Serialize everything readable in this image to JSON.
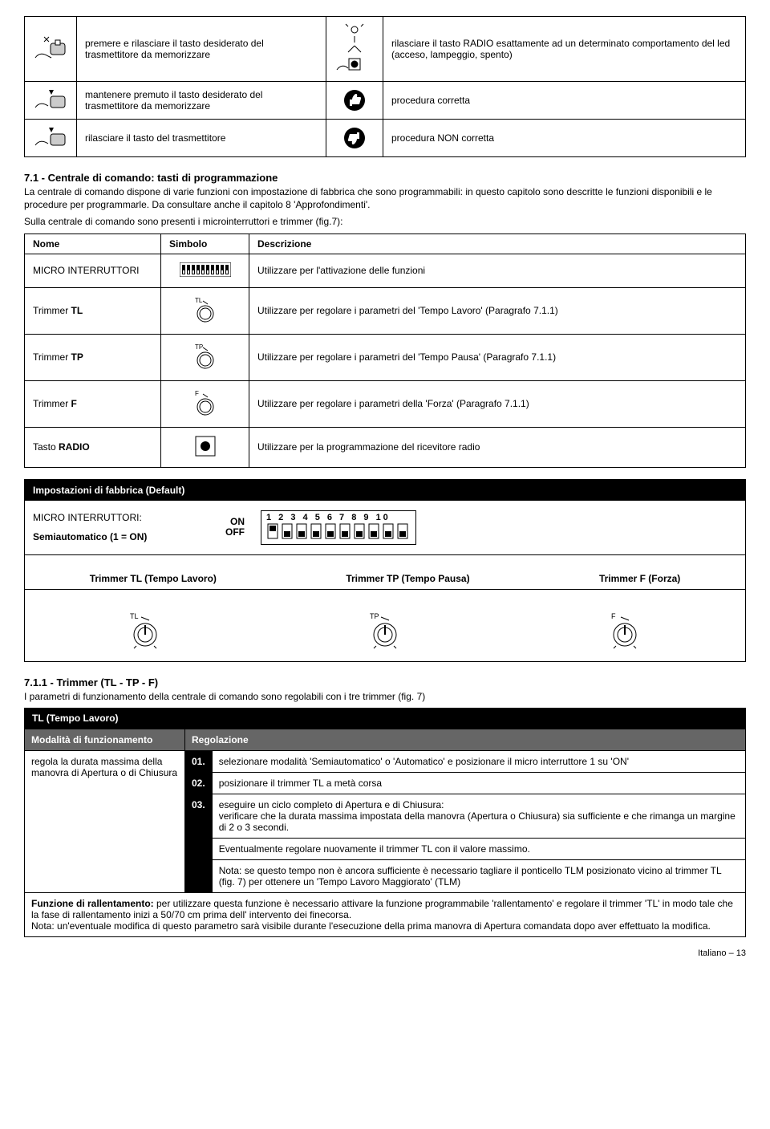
{
  "tbl1": {
    "r1a": "premere e rilasciare il tasto desiderato del trasmettitore da memorizzare",
    "r1b": "rilasciare il tasto RADIO esattamente ad un determinato comportamento del led (acceso, lampeggio, spento)",
    "r2a": "mantenere premuto il tasto desiderato del trasmettitore da memorizzare",
    "r2b": "procedura corretta",
    "r3a": "rilasciare il tasto del trasmettitore",
    "r3b": "procedura NON corretta"
  },
  "section71": {
    "title": "7.1 - Centrale di comando: tasti di programmazione",
    "p1": "La centrale di comando dispone di varie funzioni con impostazione di fabbrica che sono programmabili: in questo capitolo sono descritte le funzioni disponibili e le procedure per programmarle. Da consultare anche il capitolo 8 'Approfondimenti'.",
    "p2": "Sulla centrale di comando sono presenti i microinterruttori e trimmer (fig.7):"
  },
  "nome": {
    "h1": "Nome",
    "h2": "Simbolo",
    "h3": "Descrizione",
    "r1n": "MICRO INTERRUTTORI",
    "r1d": "Utilizzare per l'attivazione delle funzioni",
    "r2n": "Trimmer TL",
    "r2d": "Utilizzare per regolare i parametri del 'Tempo Lavoro' (Paragrafo 7.1.1)",
    "r3n": "Trimmer TP",
    "r3d": "Utilizzare per regolare i parametri del 'Tempo Pausa' (Paragrafo 7.1.1)",
    "r4n": "Trimmer F",
    "r4d": "Utilizzare per regolare i parametri della 'Forza' (Paragrafo 7.1.1)",
    "r5n": "Tasto RADIO",
    "r5d": "Utilizzare per la programmazione del ricevitore radio"
  },
  "defaults": {
    "title": "Impostazioni di fabbrica (Default)",
    "mi": "MICRO INTERRUTTORI:",
    "semi": "Semiautomatico (1 = ON)",
    "on": "ON",
    "off": "OFF",
    "nums": "1  2  3  4  5  6  7  8  9 10",
    "tl": "Trimmer TL (Tempo Lavoro)",
    "tp": "Trimmer TP (Tempo Pausa)",
    "tf": "Trimmer F (Forza)",
    "tl_s": "TL",
    "tp_s": "TP",
    "f_s": "F"
  },
  "section711": {
    "title": "7.1.1 - Trimmer (TL - TP - F)",
    "p": "I parametri di funzionamento della centrale di comando sono regolabili con i tre trimmer (fig. 7)"
  },
  "tl": {
    "title": "TL (Tempo Lavoro)",
    "modh": "Modalità di funzionamento",
    "regh": "Regolazione",
    "mod": "regola la durata massima della manovra di Apertura o di Chiusura",
    "s1": "selezionare modalità 'Semiautomatico' o 'Automatico' e posizionare il micro interruttore 1 su 'ON'",
    "s2": "posizionare il trimmer TL a metà corsa",
    "s3a": "eseguire un ciclo completo di Apertura e di Chiusura:",
    "s3b": "verificare che la durata massima impostata della manovra (Apertura o Chiusura) sia sufficiente e che rimanga un margine di 2 o 3 secondi.",
    "s3c": "Eventualmente regolare nuovamente il trimmer TL con il valore massimo.",
    "s3d": "Nota: se questo tempo non è ancora sufficiente è necessario tagliare il ponticello TLM posizionato vicino al trimmer TL (fig. 7) per ottenere un 'Tempo Lavoro Maggiorato' (TLM)",
    "funz1": "Funzione di rallentamento:",
    "funz2": " per utilizzare questa funzione è necessario attivare la funzione programmabile 'rallentamento' e regolare il trimmer 'TL' in modo tale che la fase di rallentamento inizi a 50/70 cm prima dell' intervento dei finecorsa.",
    "funz3": "Nota: un'eventuale modifica di questo parametro sarà visibile durante l'esecuzione della prima manovra di Apertura comandata dopo aver effettuato la modifica."
  },
  "footer": "Italiano – 13"
}
